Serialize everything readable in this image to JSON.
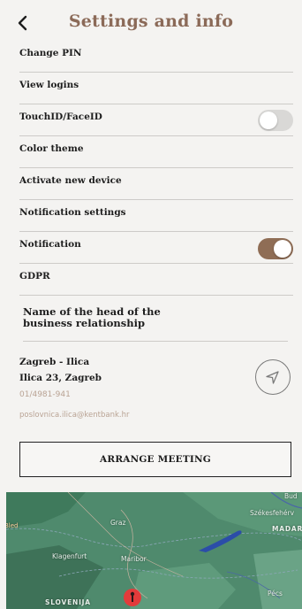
{
  "header": {
    "title": "Settings and info",
    "back_icon": "chevron-left-icon"
  },
  "settings": {
    "items": [
      {
        "label": "Change PIN"
      },
      {
        "label": "View logins"
      },
      {
        "label": "TouchID/FaceID",
        "toggle": "off"
      },
      {
        "label": "Color theme"
      },
      {
        "label": "Activate new device"
      },
      {
        "label": "Notification settings"
      },
      {
        "label": "Notification",
        "toggle": "on"
      },
      {
        "label": "GDPR"
      }
    ]
  },
  "relationship": {
    "title": "Name of the head of the business relationship"
  },
  "branch": {
    "name": "Zagreb - Ilica",
    "address": "Ilica 23, Zagreb",
    "phone": "01/4981-941",
    "email": "poslovnica.ilica@kentbank.hr",
    "navigate_icon": "navigation-arrow-icon"
  },
  "actions": {
    "arrange_meeting": "ARRANGE MEETING"
  },
  "map": {
    "labels": {
      "graz": "Graz",
      "klagenfurt": "Klagenfurt",
      "maribor": "Maribor",
      "szekesfehervar": "Székesfehérv",
      "madar": "MADAR",
      "pecs": "Pécs",
      "slovenija": "SLOVENIJA",
      "partial_left": "Bled",
      "partial_top": "Bud"
    },
    "marker_icon": "map-pin-icon"
  },
  "colors": {
    "accent": "#8b6a58",
    "toggle_on": "#8f6d55",
    "toggle_off": "#d9d8d6",
    "muted_text": "#b9a394",
    "background": "#f4f3f1",
    "map_green": "#4f8a6d",
    "marker_red": "#e23b3b"
  }
}
